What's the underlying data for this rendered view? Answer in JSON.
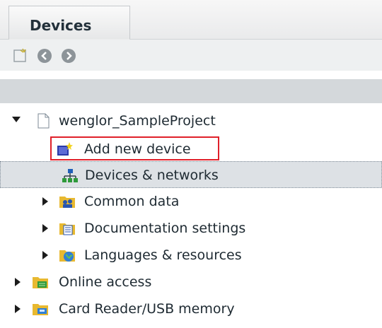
{
  "tabs": {
    "devices": "Devices"
  },
  "toolbar": [
    {
      "name": "new-device-icon"
    },
    {
      "name": "back-icon"
    },
    {
      "name": "forward-icon"
    }
  ],
  "tree": {
    "project": "wenglor_SampleProject",
    "add_new_device": "Add new device",
    "devices_networks": "Devices & networks",
    "common_data": "Common data",
    "documentation_settings": "Documentation settings",
    "languages_resources": "Languages & resources",
    "online_access": "Online access",
    "card_reader": "Card Reader/USB memory"
  },
  "colors": {
    "highlight": "#e0202a",
    "selected_row": "#dde1e5"
  }
}
